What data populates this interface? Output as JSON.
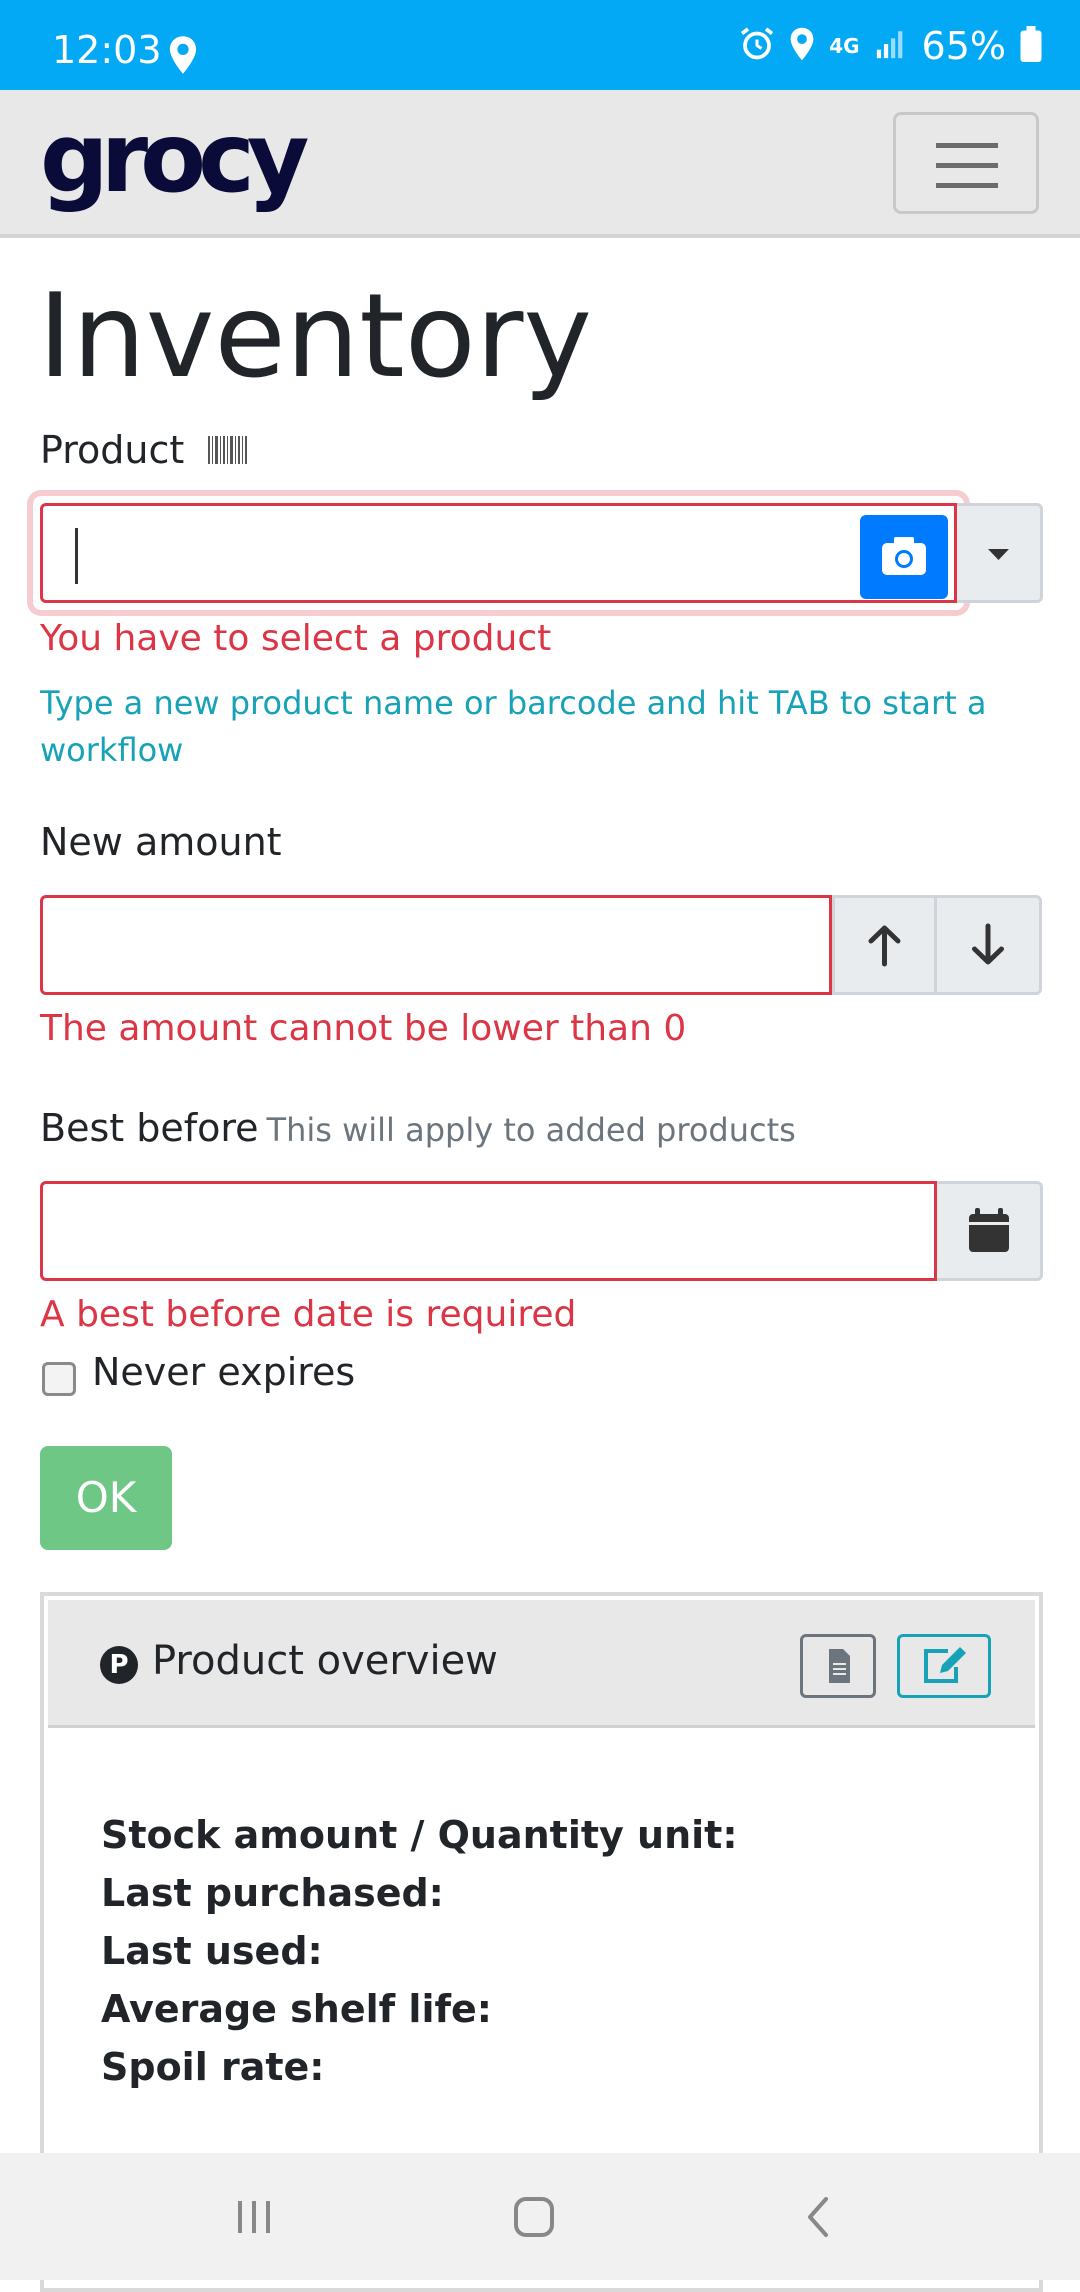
{
  "status_bar": {
    "time": "12:03",
    "network": "4G",
    "battery": "65%"
  },
  "navbar": {
    "logo": "grocy"
  },
  "page": {
    "title": "Inventory"
  },
  "form": {
    "product_label": "Product",
    "product_value": "",
    "product_error": "You have to select a product",
    "product_hint": "Type a new product name or barcode and hit TAB to start a workflow",
    "amount_label": "New amount",
    "amount_value": "",
    "amount_error": "The amount cannot be lower than 0",
    "best_before_label": "Best before",
    "best_before_note": "This will apply to added products",
    "best_before_value": "",
    "best_before_error": "A best before date is required",
    "never_expires_label": "Never expires",
    "never_expires_checked": false,
    "ok_label": "OK"
  },
  "overview": {
    "title": "Product overview",
    "stock_label": "Stock amount / Quantity unit:",
    "last_purchased_label": "Last purchased:",
    "last_used_label": "Last used:",
    "avg_shelf_label": "Average shelf life:",
    "spoil_rate_label": "Spoil rate:"
  },
  "colors": {
    "status_bar": "#03a9f4",
    "error": "#dc3545",
    "primary": "#007bff",
    "info": "#17a2b8",
    "success": "#6fc786"
  }
}
